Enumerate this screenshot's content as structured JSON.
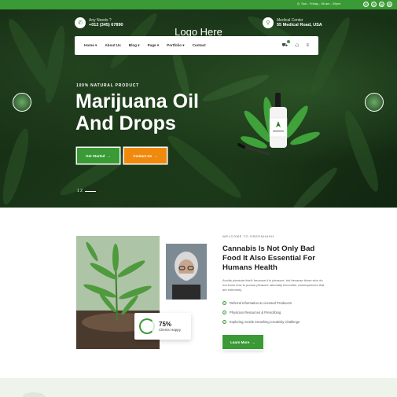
{
  "topbar": {
    "hours": "Sun - Friday , 08 am - 09pm",
    "socials": [
      "facebook-icon",
      "twitter-icon",
      "google-icon"
    ]
  },
  "header": {
    "phone_label": "Any Needs ?",
    "phone_value": "+012 (345) 67890",
    "logo": "Logo Here",
    "address_label": "Medical Center",
    "address_value": "55 Medical Road, USA"
  },
  "nav": {
    "items": [
      "Home ▾",
      "About Us",
      "Blog ▾",
      "Page ▾",
      "Portfolio ▾",
      "Contact"
    ]
  },
  "hero": {
    "tag": "100% NATURAL PRODUCT",
    "line1": "Marijuana Oil",
    "line2": "And Drops",
    "btn_primary": "Get Started",
    "btn_secondary": "Contact Us",
    "slider_index": "1   2"
  },
  "about": {
    "welcome": "WELCOME TO GREENHASH",
    "title": "Cannabis Is Not Only Bad Food It Also Essential For Humans Health",
    "text": "Avoids pleasure itself, because it is pleasure, but because those who do not know how to pursue pleasure rationally encounter consequences that are extremely.",
    "checks": [
      "Referral Information & Licensed Producers",
      "Physician Resources & Prescribing",
      "Exploring Avoids Smashing Creativity Challenge"
    ],
    "stat_value": "75%",
    "stat_label": "Clients Happy",
    "button": "Learn More"
  },
  "colors": {
    "brand_green": "#3a9a35",
    "accent_orange": "#f08a0e"
  }
}
